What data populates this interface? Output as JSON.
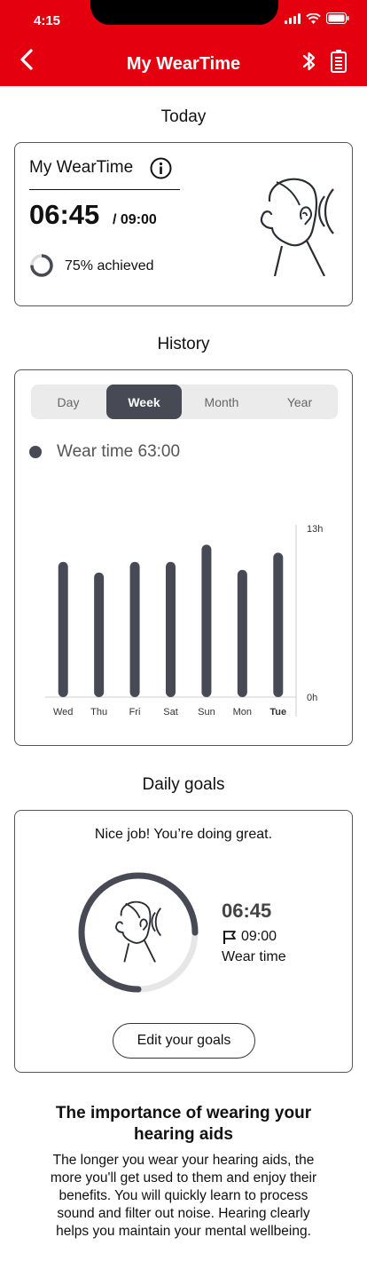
{
  "status_bar": {
    "time": "4:15"
  },
  "nav": {
    "title": "My WearTime",
    "back_icon": "chevron-left-icon",
    "bluetooth_icon": "bluetooth-icon",
    "battery_icon": "battery-icon"
  },
  "today": {
    "section_title": "Today",
    "card_title": "My WearTime",
    "wear_time": "06:45",
    "goal": "/ 09:00",
    "achieved_text": "75% achieved",
    "achieved_fraction": 0.75
  },
  "history": {
    "section_title": "History",
    "tabs": [
      {
        "label": "Day"
      },
      {
        "label": "Week"
      },
      {
        "label": "Month"
      },
      {
        "label": "Year"
      }
    ],
    "active_tab": "Week",
    "legend": "Wear time 63:00"
  },
  "chart_data": {
    "type": "bar",
    "categories": [
      "Wed",
      "Thu",
      "Fri",
      "Sat",
      "Sun",
      "Mon",
      "Tue"
    ],
    "values": [
      10.2,
      9.4,
      10.2,
      10.2,
      11.5,
      9.6,
      10.9
    ],
    "highlight_category": "Tue",
    "ylim": [
      0,
      13
    ],
    "y_ticks": [
      "0h",
      "13h"
    ],
    "grid": false,
    "colors": {
      "bar": "#474a54"
    }
  },
  "goals": {
    "section_title": "Daily goals",
    "message": "Nice job! You’re doing great.",
    "wear_time": "06:45",
    "goal": "09:00",
    "label": "Wear time",
    "progress_fraction": 0.75,
    "edit_button": "Edit your goals"
  },
  "importance": {
    "title": "The importance of wearing your hearing aids",
    "body": "The longer you wear your hearing aids, the more you'll get used to them and enjoy their benefits. You will quickly learn to process sound and filter out noise. Hearing clearly helps you maintain your mental wellbeing."
  },
  "colors": {
    "brand": "#e4000f",
    "accent": "#474a54"
  }
}
